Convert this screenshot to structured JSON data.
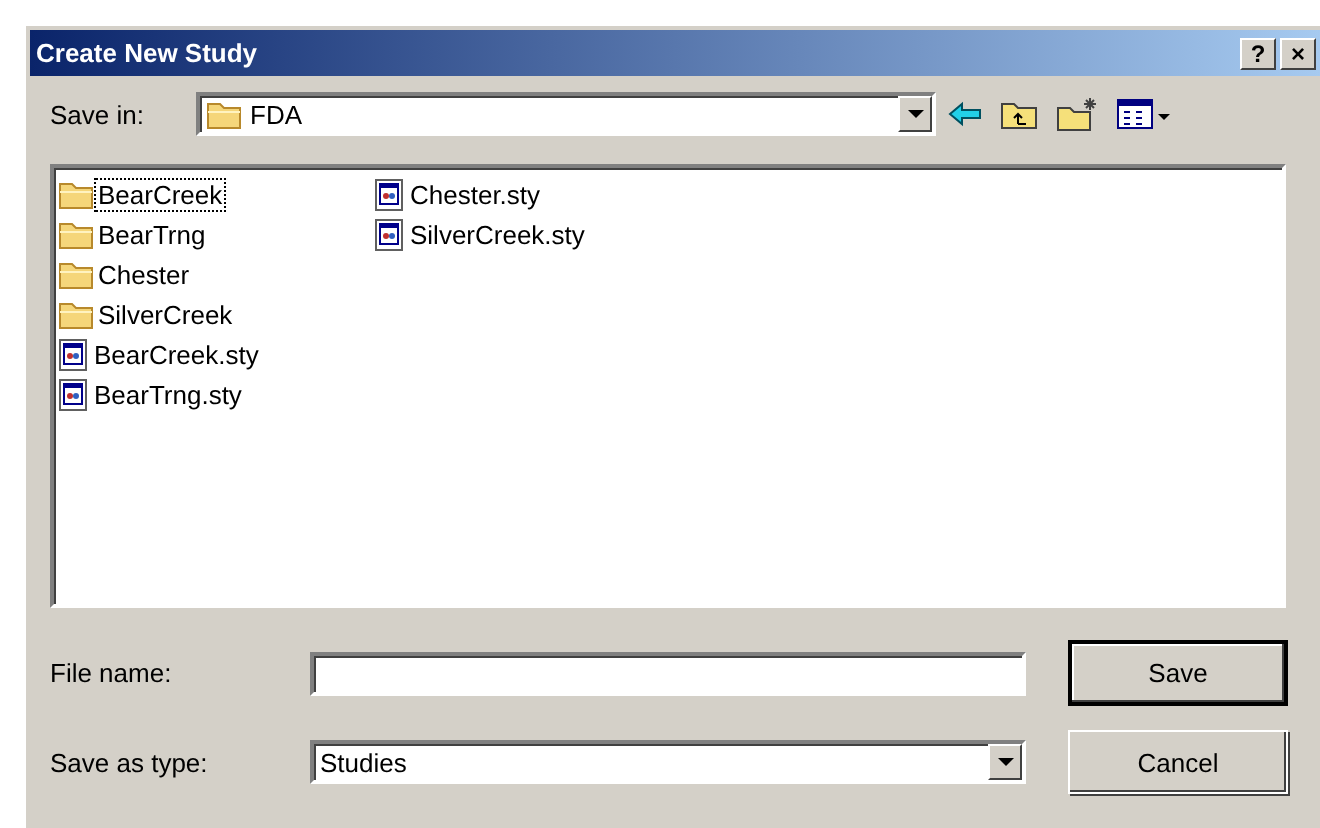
{
  "window": {
    "title": "Create New Study",
    "buttons": [
      "?",
      "×"
    ]
  },
  "save_in": {
    "label": "Save in:",
    "value": "FDA"
  },
  "items": [
    {
      "kind": "folder",
      "name": "BearCreek",
      "focused": true
    },
    {
      "kind": "folder",
      "name": "BearTrng",
      "focused": false
    },
    {
      "kind": "folder",
      "name": "Chester",
      "focused": false
    },
    {
      "kind": "folder",
      "name": "SilverCreek",
      "focused": false
    },
    {
      "kind": "file",
      "name": "BearCreek.sty",
      "focused": false
    },
    {
      "kind": "file",
      "name": "BearTrng.sty",
      "focused": false
    },
    {
      "kind": "file",
      "name": "Chester.sty",
      "focused": false
    },
    {
      "kind": "file",
      "name": "SilverCreek.sty",
      "focused": false
    }
  ],
  "file_name": {
    "label": "File name:"
  },
  "save_as_type": {
    "label": "Save as type:",
    "value": "Studies"
  },
  "actions": [
    {
      "label": "Save",
      "default": true
    },
    {
      "label": "Cancel",
      "default": false
    }
  ]
}
